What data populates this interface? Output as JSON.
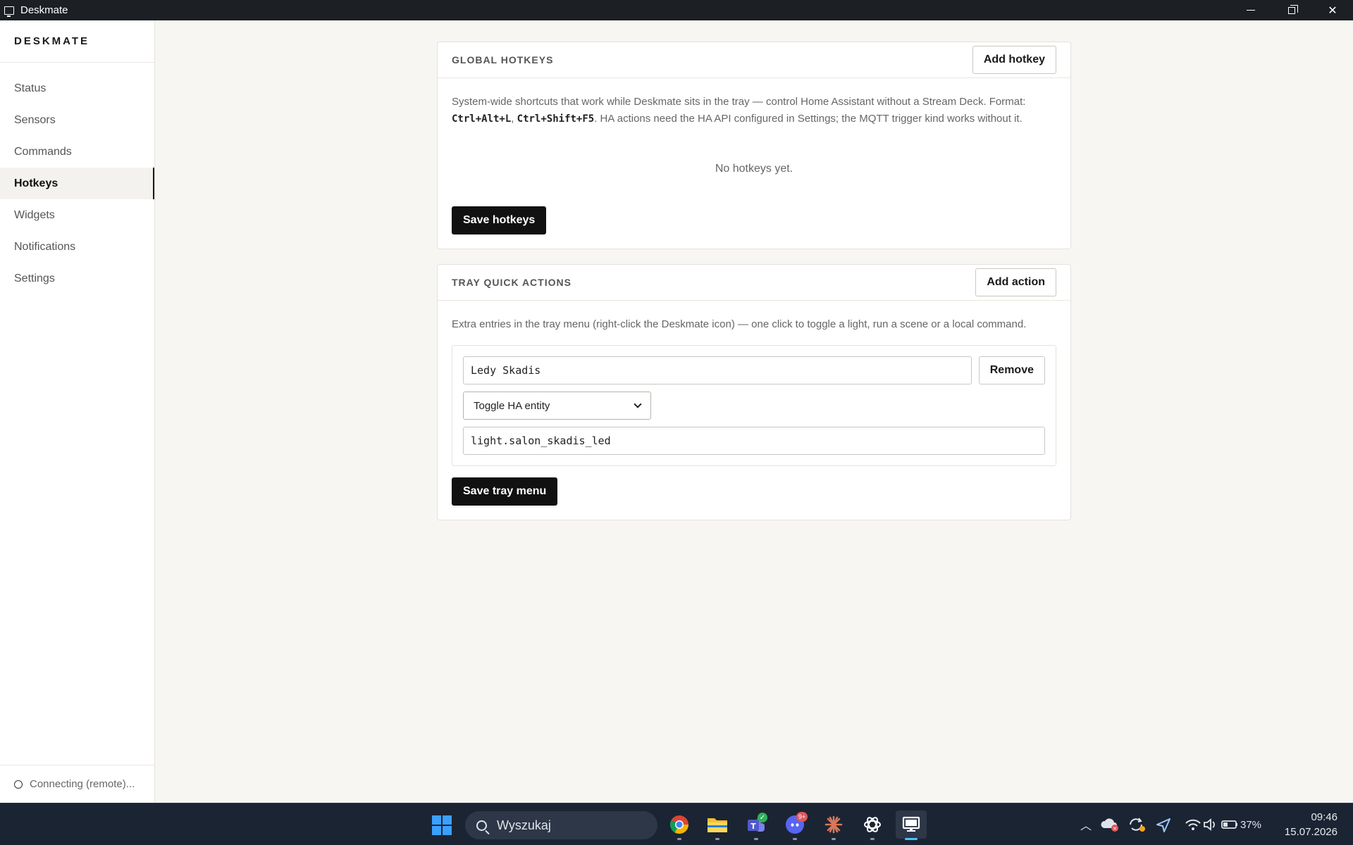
{
  "window": {
    "title": "Deskmate"
  },
  "sidebar": {
    "brand": "DESKMATE",
    "items": [
      {
        "label": "Status",
        "active": false
      },
      {
        "label": "Sensors",
        "active": false
      },
      {
        "label": "Commands",
        "active": false
      },
      {
        "label": "Hotkeys",
        "active": true
      },
      {
        "label": "Widgets",
        "active": false
      },
      {
        "label": "Notifications",
        "active": false
      },
      {
        "label": "Settings",
        "active": false
      }
    ],
    "status": "Connecting (remote)..."
  },
  "hotkeys": {
    "title": "GLOBAL HOTKEYS",
    "add_label": "Add hotkey",
    "desc_1": "System-wide shortcuts that work while Deskmate sits in the tray — control Home Assistant without a Stream Deck. Format:",
    "example_1": "Ctrl+Alt+L",
    "sep": ",",
    "example_2": "Ctrl+Shift+F5",
    "desc_2": ". HA actions need the HA API configured in Settings; the MQTT trigger kind works without it.",
    "empty": "No hotkeys yet.",
    "save_label": "Save hotkeys"
  },
  "tray": {
    "title": "TRAY QUICK ACTIONS",
    "add_label": "Add action",
    "desc": "Extra entries in the tray menu (right-click the Deskmate icon) — one click to toggle a light, run a scene or a local command.",
    "actions": [
      {
        "name": "Ledy Skadis",
        "remove_label": "Remove",
        "kind": "Toggle HA entity",
        "target": "light.salon_skadis_led"
      }
    ],
    "save_label": "Save tray menu"
  },
  "taskbar": {
    "search_placeholder": "Wyszukaj",
    "discord_badge": "9+",
    "battery": "37%",
    "time": "09:46",
    "date": "15.07.2026"
  },
  "colors": {
    "accent": "#111111",
    "taskbar": "#1b2433",
    "titlebar": "#1c1f24",
    "active_indicator": "#4cc2ff"
  }
}
